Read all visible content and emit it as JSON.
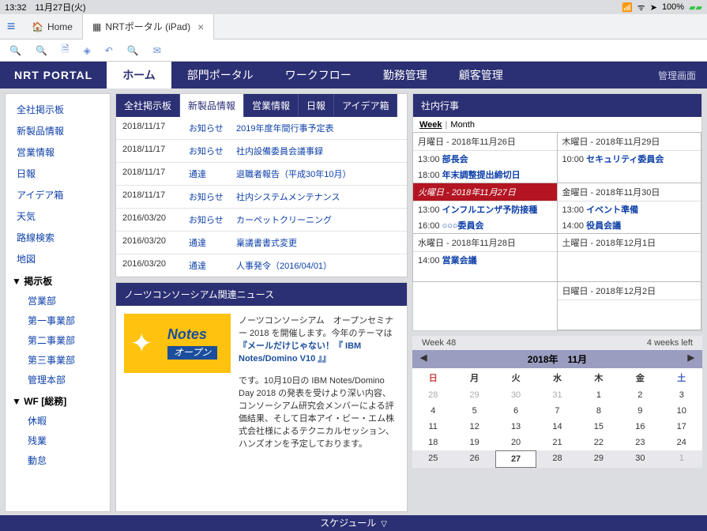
{
  "status": {
    "time": "13:32",
    "date": "11月27日(火)",
    "battery": "100%"
  },
  "browser_tabs": [
    {
      "label": "Home",
      "active": false,
      "closable": false
    },
    {
      "label": "NRTポータル (iPad)",
      "active": true,
      "closable": true
    }
  ],
  "brand": "NRT PORTAL",
  "nav": {
    "items": [
      "ホーム",
      "部門ポータル",
      "ワークフロー",
      "勤務管理",
      "顧客管理"
    ],
    "active_index": 0,
    "admin": "管理画面"
  },
  "sidebar": {
    "top": [
      "全社掲示板",
      "新製品情報",
      "営業情報",
      "日報",
      "アイデア箱",
      "天気",
      "路線検索",
      "地図"
    ],
    "sec1": {
      "title": "掲示板",
      "items": [
        "営業部",
        "第一事業部",
        "第二事業部",
        "第三事業部",
        "管理本部"
      ]
    },
    "sec2": {
      "title": "WF [総務]",
      "items": [
        "休暇",
        "残業",
        "動怠"
      ]
    }
  },
  "center_tabs": {
    "items": [
      "全社掲示板",
      "新製品情報",
      "営業情報",
      "日報",
      "アイデア箱"
    ],
    "active_index": 1
  },
  "board": [
    {
      "date": "2018/11/17",
      "type": "お知らせ",
      "title": "2019年度年間行事予定表"
    },
    {
      "date": "2018/11/17",
      "type": "お知らせ",
      "title": "社内設備委員会議事録"
    },
    {
      "date": "2018/11/17",
      "type": "通達",
      "title": "退職者報告（平成30年10月）"
    },
    {
      "date": "2018/11/17",
      "type": "お知らせ",
      "title": "社内システムメンテナンス"
    },
    {
      "date": "2016/03/20",
      "type": "お知らせ",
      "title": "カーペットクリーニング"
    },
    {
      "date": "2016/03/20",
      "type": "通達",
      "title": "稟議書書式変更"
    },
    {
      "date": "2016/03/20",
      "type": "通達",
      "title": "人事発令（2016/04/01）"
    }
  ],
  "news": {
    "header": "ノーツコンソーシアム関連ニュース",
    "logo_line1": "Notes",
    "logo_line2": "オープン",
    "intro": "ノーツコンソーシアム　オープンセミナー 2018 を開催します。今年のテーマは",
    "link": "『メールだけじゃない！『 IBM Notes/Domino V10 』』",
    "body": "です。10月10日の IBM Notes/Domino Day 2018 の発表を受けより深い内容、コンソーシアム研究会メンバーによる評価結果、そして日本アイ・ビー・エム株式会社様によるテクニカルセッション、ハンズオンを予定しております。"
  },
  "events": {
    "header": "社内行事",
    "view": {
      "week": "Week",
      "month": "Month"
    },
    "days": [
      {
        "label": "月曜日 - 2018年11月26日",
        "evs": [
          {
            "t": "13:00",
            "n": "部長会"
          },
          {
            "t": "18:00",
            "n": "年末調整提出締切日"
          }
        ]
      },
      {
        "label": "木曜日 - 2018年11月29日",
        "evs": [
          {
            "t": "10:00",
            "n": "セキュリティ委員会"
          }
        ]
      },
      {
        "label": "火曜日 - 2018年11月27日",
        "today": true,
        "evs": [
          {
            "t": "13:00",
            "n": "インフルエンザ予防接種"
          },
          {
            "t": "16:00",
            "n": "○○○委員会"
          }
        ]
      },
      {
        "label": "金曜日 - 2018年11月30日",
        "evs": [
          {
            "t": "13:00",
            "n": "イベント準備"
          },
          {
            "t": "14:00",
            "n": "役員会議"
          }
        ]
      },
      {
        "label": "水曜日 - 2018年11月28日",
        "evs": [
          {
            "t": "14:00",
            "n": "営業会議"
          }
        ]
      },
      {
        "label": "土曜日 - 2018年12月1日",
        "evs": []
      },
      {
        "label": "",
        "evs": [],
        "empty": true
      },
      {
        "label": "日曜日 - 2018年12月2日",
        "evs": [],
        "short": true
      }
    ]
  },
  "cal": {
    "week_label": "Week 48",
    "weeks_left": "4 weeks left",
    "title": "2018年　11月",
    "dow": [
      "日",
      "月",
      "火",
      "水",
      "木",
      "金",
      "土"
    ],
    "grid": [
      [
        28,
        29,
        30,
        31,
        1,
        2,
        3
      ],
      [
        4,
        5,
        6,
        7,
        8,
        9,
        10
      ],
      [
        11,
        12,
        13,
        14,
        15,
        16,
        17
      ],
      [
        18,
        19,
        20,
        21,
        22,
        23,
        24
      ],
      [
        25,
        26,
        27,
        28,
        29,
        30,
        1
      ]
    ],
    "today": 27,
    "current_row": 4,
    "other_before": 4,
    "other_after": 1
  },
  "footer": "スケジュール"
}
